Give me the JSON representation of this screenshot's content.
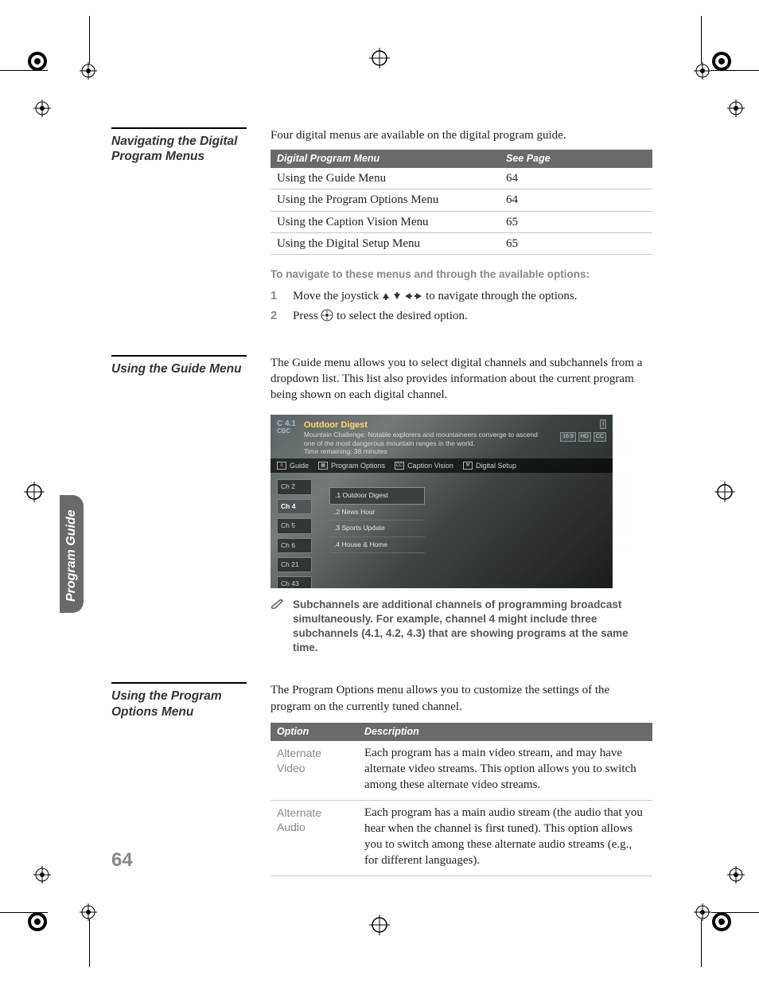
{
  "side_label": "Program Guide",
  "page_number": "64",
  "sec1": {
    "head": "Navigating the Digital Program Menus",
    "intro": "Four digital menus are available on the digital program guide.",
    "th1": "Digital Program Menu",
    "th2": "See Page",
    "rows": [
      {
        "a": "Using the Guide Menu",
        "b": "64"
      },
      {
        "a": "Using the Program Options Menu",
        "b": "64"
      },
      {
        "a": "Using the Caption Vision Menu",
        "b": "65"
      },
      {
        "a": "Using the Digital Setup Menu",
        "b": "65"
      }
    ],
    "nav_note": "To navigate to these menus and through the available options:",
    "step1a": "Move the joystick ",
    "step1b": " to navigate through the options.",
    "step2a": "Press ",
    "step2b": " to select the desired option."
  },
  "sec2": {
    "head": "Using the Guide Menu",
    "para": "The Guide menu allows you to select digital channels and subchannels from a dropdown list. This list also provides information about the current program being shown on each digital channel.",
    "shot": {
      "ch": "C 4.1",
      "net": "CBC",
      "title": "Outdoor Digest",
      "desc": "Mountain Challenge: Notable explorers and mountaineers converge to ascend one of the most dangerous mountain ranges in the world.",
      "time": "Time remaining: 38 minutes",
      "badges": [
        "16:9",
        "HD",
        "CC"
      ],
      "tabs": [
        "Guide",
        "Program Options",
        "Caption Vision",
        "Digital Setup"
      ],
      "channels": [
        "Ch 2",
        "Ch 4",
        "Ch 5",
        "Ch 6",
        "Ch 21",
        "Ch 43"
      ],
      "subs": [
        ".1 Outdoor Digest",
        ".2 News Hour",
        ".3 Sports Update",
        ".4 House & Home"
      ]
    },
    "note": "Subchannels are additional channels of programming broadcast simultaneously. For example, channel 4 might include three subchannels (4.1, 4.2, 4.3) that are showing programs at the same time."
  },
  "sec3": {
    "head": "Using the Program Options Menu",
    "para": "The Program Options menu allows you to customize the settings of the program on the currently tuned channel.",
    "th1": "Option",
    "th2": "Description",
    "rows": [
      {
        "a": "Alternate Video",
        "b": "Each program has a main video stream, and may have alternate video streams. This option allows you to switch among these alternate video streams."
      },
      {
        "a": "Alternate Audio",
        "b": "Each program has a main audio stream (the audio that you hear when the channel is first tuned). This option allows you to switch among these alternate audio streams (e.g., for different languages)."
      }
    ]
  }
}
